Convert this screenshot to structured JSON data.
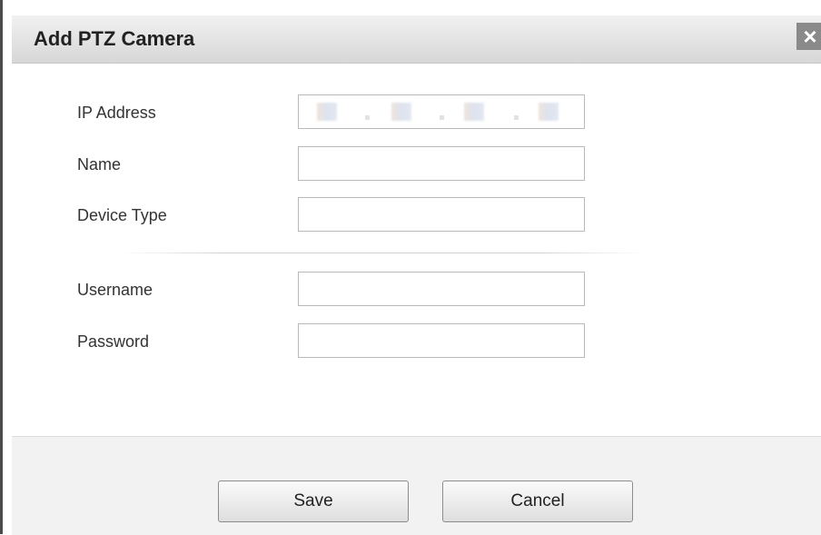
{
  "dialog": {
    "title": "Add PTZ Camera",
    "close_label": "×"
  },
  "form": {
    "ip_address": {
      "label": "IP Address"
    },
    "name": {
      "label": "Name",
      "value": ""
    },
    "device_type": {
      "label": "Device Type",
      "value": ""
    },
    "username": {
      "label": "Username",
      "value": ""
    },
    "password": {
      "label": "Password",
      "value": ""
    }
  },
  "footer": {
    "save_label": "Save",
    "cancel_label": "Cancel"
  }
}
